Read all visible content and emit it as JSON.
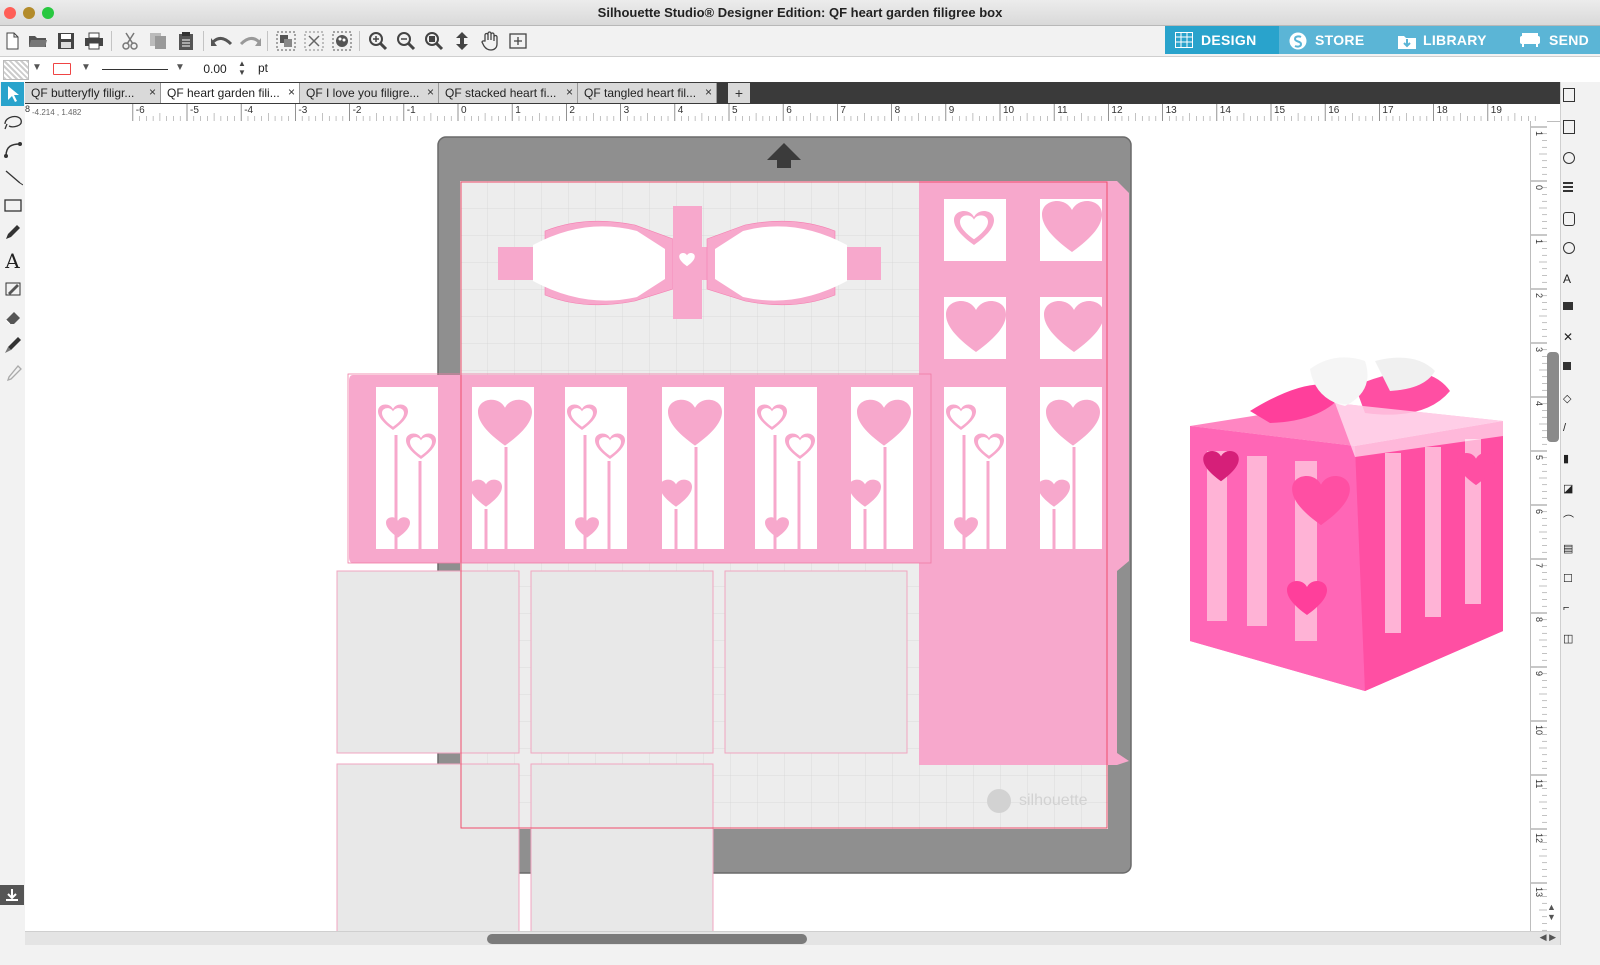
{
  "window": {
    "title": "Silhouette Studio® Designer Edition: QF heart garden filigree box",
    "traffic_lights": [
      "#ff5f57",
      "#febc2e",
      "#28c840"
    ]
  },
  "toolbar": {
    "icons": [
      "new-document-icon",
      "open-folder-icon",
      "save-icon",
      "print-icon",
      "cut-icon",
      "copy-icon",
      "paste-icon",
      "undo-icon",
      "redo-icon",
      "group-icon",
      "ungroup-icon",
      "replicate-icon",
      "zoom-in-icon",
      "zoom-out-icon",
      "zoom-fit-icon",
      "move-down-icon",
      "pan-hand-icon",
      "zoom-page-icon"
    ]
  },
  "nav": {
    "tabs": [
      {
        "label": "DESIGN",
        "color": "#29a3cc",
        "icon": "grid-icon"
      },
      {
        "label": "STORE",
        "color": "#5bb5d6",
        "icon": "silhouette-s-icon"
      },
      {
        "label": "LIBRARY",
        "color": "#5bb5d6",
        "icon": "download-icon"
      },
      {
        "label": "SEND",
        "color": "#5bb5d6",
        "icon": "cutter-icon"
      }
    ]
  },
  "line_style": {
    "line_width_value": "0.00",
    "unit": "pt",
    "stroke_color": "#ef4444"
  },
  "doc_tabs": [
    {
      "label": "QF butteryfly filigr...",
      "active": false
    },
    {
      "label": "QF heart garden fili...",
      "active": true
    },
    {
      "label": "QF I love you filigre...",
      "active": false
    },
    {
      "label": "QF stacked heart fi...",
      "active": false
    },
    {
      "label": "QF tangled heart fil...",
      "active": false
    }
  ],
  "add_tab_label": "+",
  "ruler": {
    "coords_readout": "-4.214 , 1.482",
    "h_ticks": [
      "-6",
      "-5",
      "-4",
      "-3",
      "-2",
      "-1",
      "0",
      "1",
      "2",
      "3",
      "4",
      "5",
      "6",
      "7",
      "8",
      "9",
      "10",
      "11",
      "12",
      "13",
      "14",
      "15",
      "16",
      "17",
      "18",
      "19"
    ],
    "v_ticks": [
      "1",
      "0",
      "1",
      "2",
      "3",
      "4",
      "5",
      "6",
      "7",
      "8",
      "9",
      "10",
      "11",
      "12",
      "13"
    ],
    "first_label": "8"
  },
  "canvas": {
    "mat_watermark": "silhouette",
    "pink": "#f7a8cc",
    "hot_pink": "#ff69b4"
  },
  "tools": [
    "select-arrow-icon",
    "point-edit-icon",
    "curve-icon",
    "line-tool-icon",
    "rectangle-tool-icon",
    "pencil-tool-icon",
    "text-tool-icon",
    "sketch-icon",
    "eraser-icon",
    "knife-icon",
    "eyedropper-icon"
  ]
}
